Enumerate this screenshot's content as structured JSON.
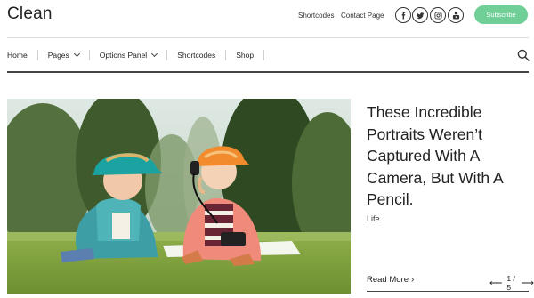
{
  "brand": "Clean",
  "top_links": [
    "Shortcodes",
    "Contact Page"
  ],
  "social_icons": [
    "facebook-icon",
    "twitter-icon",
    "instagram-icon",
    "youtube-icon"
  ],
  "subscribe_label": "Subscribe",
  "nav": [
    {
      "label": "Home",
      "has_dropdown": false
    },
    {
      "label": "Pages",
      "has_dropdown": true
    },
    {
      "label": "Options Panel",
      "has_dropdown": true
    },
    {
      "label": "Shortcodes",
      "has_dropdown": false
    },
    {
      "label": "Shop",
      "has_dropdown": false
    }
  ],
  "colors": {
    "accent": "#6fcf97",
    "text": "#222222",
    "rule": "#444444"
  },
  "featured": {
    "headline": "These Incredible Portraits Weren’t Captured With A Camera, But With A Pencil.",
    "category": "Life",
    "read_more": "Read More",
    "pager": "1 / 5"
  }
}
